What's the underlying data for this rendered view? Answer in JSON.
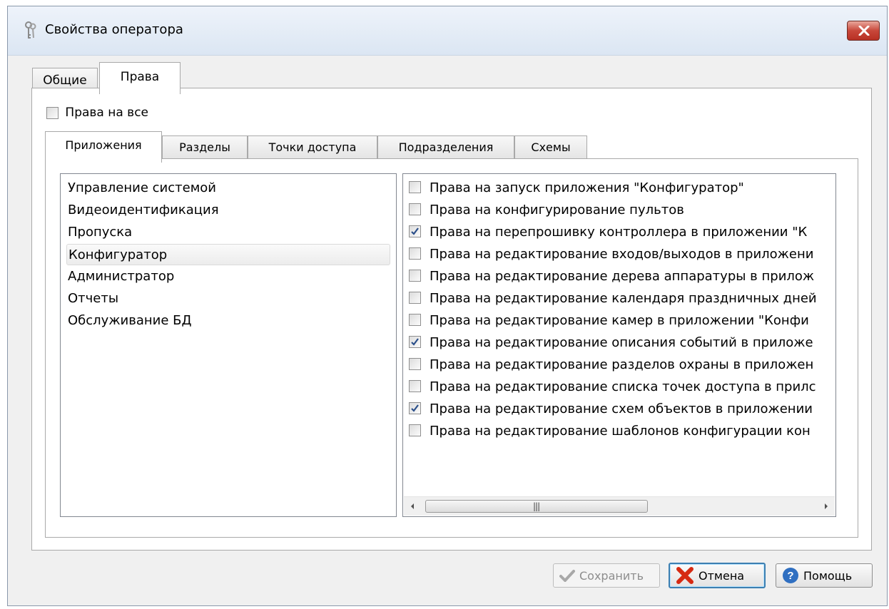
{
  "window": {
    "title": "Свойства оператора",
    "icon": "keys-icon"
  },
  "tabs": [
    {
      "label": "Общие",
      "active": false
    },
    {
      "label": "Права",
      "active": true
    }
  ],
  "all_rights": {
    "label": "Права на все",
    "checked": false
  },
  "subtabs": [
    {
      "label": "Приложения",
      "active": true
    },
    {
      "label": "Разделы",
      "active": false
    },
    {
      "label": "Точки доступа",
      "active": false
    },
    {
      "label": "Подразделения",
      "active": false
    },
    {
      "label": "Схемы",
      "active": false
    }
  ],
  "applications": [
    {
      "label": "Управление системой"
    },
    {
      "label": "Видеоидентификация"
    },
    {
      "label": "Пропуска"
    },
    {
      "label": "Конфигуратор",
      "selected": true
    },
    {
      "label": "Администратор"
    },
    {
      "label": "Отчеты"
    },
    {
      "label": "Обслуживание БД"
    }
  ],
  "permissions": [
    {
      "label": "Права на запуск приложения \"Конфигуратор\"",
      "checked": false
    },
    {
      "label": "Права на конфигурирование пультов",
      "checked": false
    },
    {
      "label": "Права на перепрошивку контроллера в приложении \"К",
      "checked": true
    },
    {
      "label": "Права на редактирование входов/выходов в приложени",
      "checked": false
    },
    {
      "label": "Права на редактирование дерева аппаратуры в прилож",
      "checked": false
    },
    {
      "label": "Права на редактирование календаря праздничных дней",
      "checked": false
    },
    {
      "label": "Права на редактирование камер в приложении \"Конфи",
      "checked": false
    },
    {
      "label": "Права на редактирование описания событий в приложе",
      "checked": true
    },
    {
      "label": "Права на редактирование разделов охраны в приложен",
      "checked": false
    },
    {
      "label": "Права на редактирование списка точек доступа в прилс",
      "checked": false
    },
    {
      "label": "Права на редактирование схем объектов в приложении",
      "checked": true
    },
    {
      "label": "Права на редактирование шаблонов конфигурации кон",
      "checked": false
    }
  ],
  "buttons": {
    "save": "Сохранить",
    "cancel": "Отмена",
    "help": "Помощь"
  }
}
